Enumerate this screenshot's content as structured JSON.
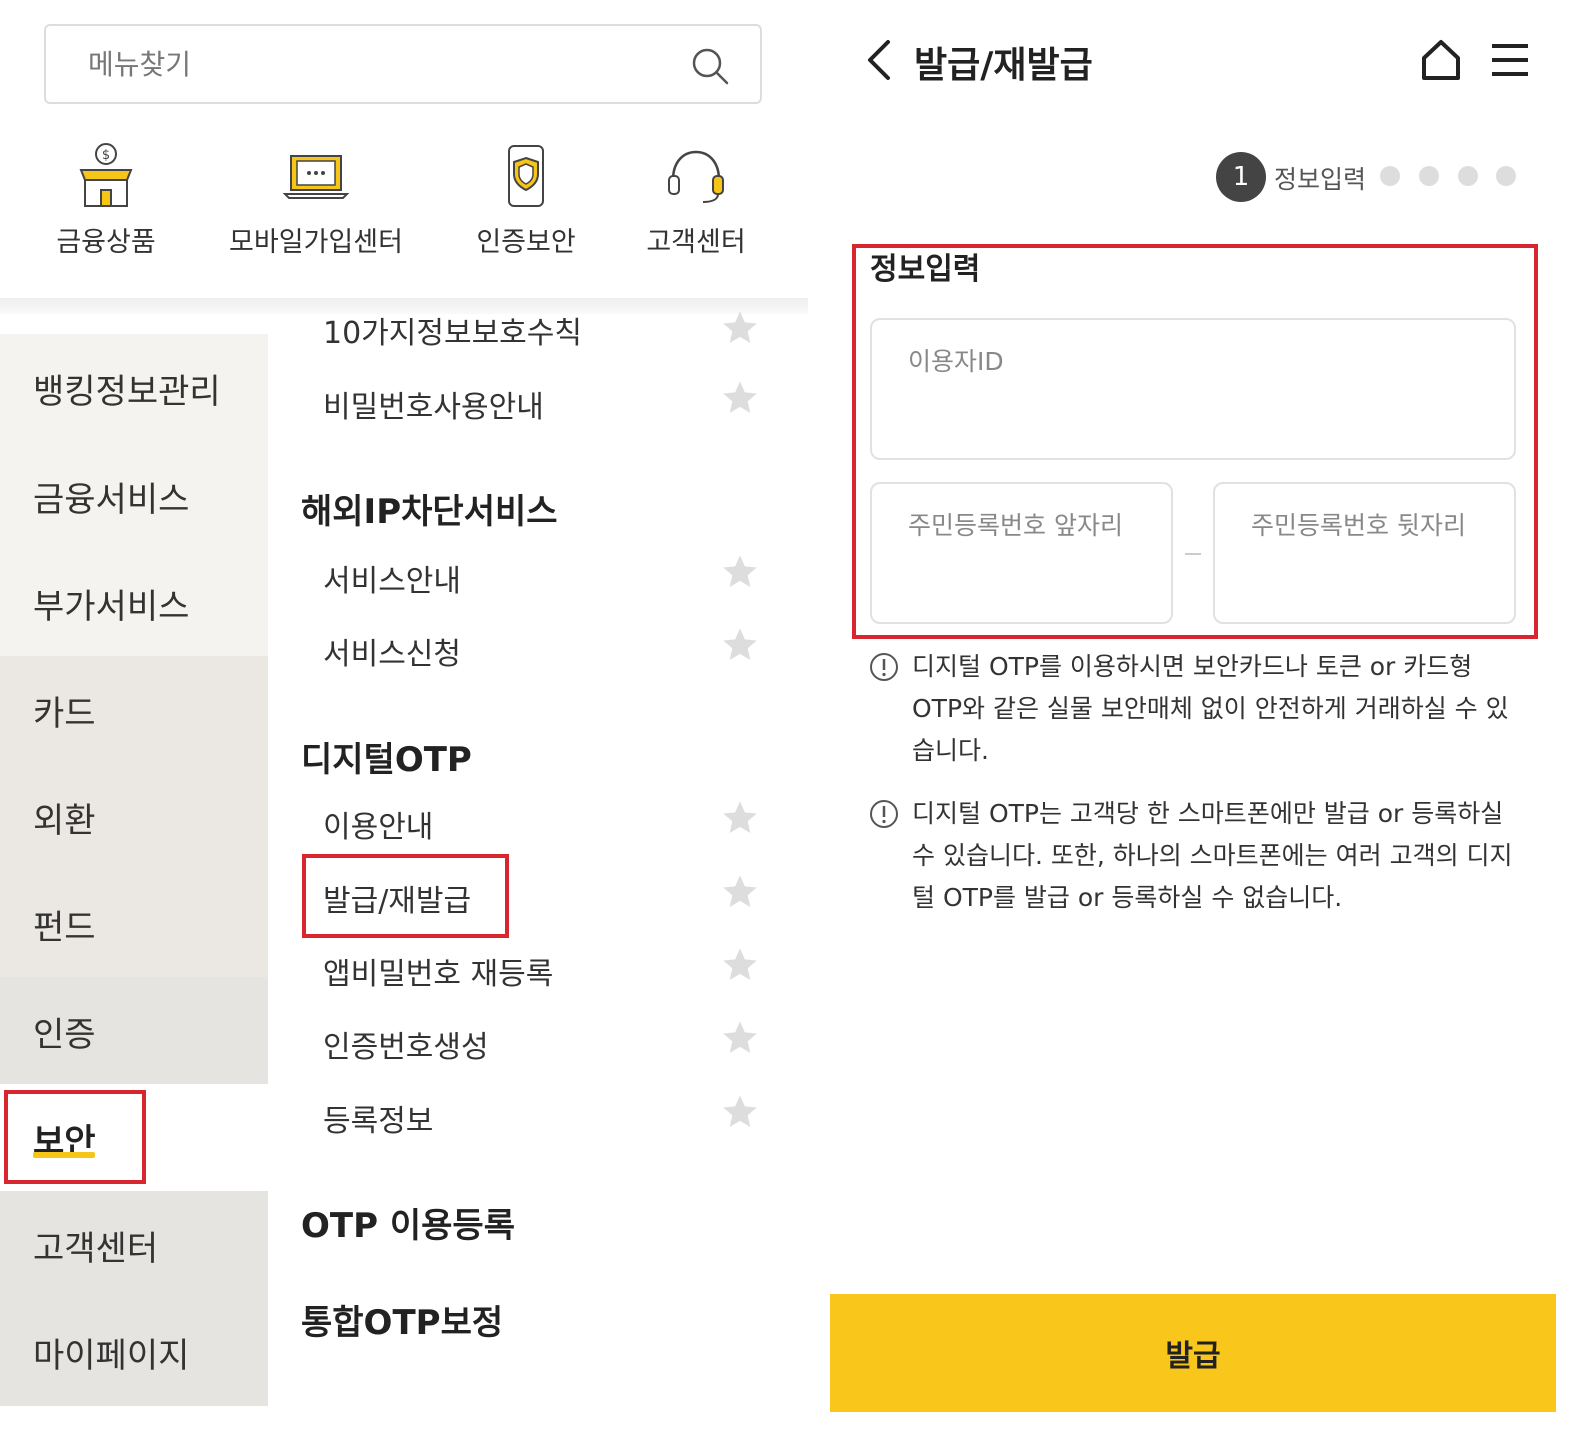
{
  "search": {
    "placeholder": "메뉴찾기"
  },
  "quick_menu": [
    {
      "label": "금융상품",
      "icon": "store-money-icon"
    },
    {
      "label": "모바일가입센터",
      "icon": "laptop-chat-icon"
    },
    {
      "label": "인증보안",
      "icon": "phone-shield-icon"
    },
    {
      "label": "고객센터",
      "icon": "headset-icon"
    }
  ],
  "sidebar": {
    "items": [
      "뱅킹정보관리",
      "금융서비스",
      "부가서비스",
      "카드",
      "외환",
      "펀드",
      "인증",
      "보안",
      "고객센터",
      "마이페이지"
    ],
    "active": "보안"
  },
  "menu": {
    "top_items": [
      "10가지정보보호수칙",
      "비밀번호사용안내"
    ],
    "section1": {
      "title": "해외IP차단서비스",
      "items": [
        "서비스안내",
        "서비스신청"
      ]
    },
    "section2": {
      "title": "디지털OTP",
      "items": [
        "이용안내",
        "발급/재발급",
        "앱비밀번호 재등록",
        "인증번호생성",
        "등록정보"
      ]
    },
    "section3": {
      "title": "OTP 이용등록"
    },
    "section4": {
      "title": "통합OTP보정"
    }
  },
  "header": {
    "title": "발급/재발급"
  },
  "stepper": {
    "current": "1",
    "label": "정보입력"
  },
  "form": {
    "section_title": "정보입력",
    "user_id_placeholder": "이용자ID",
    "rrn_front_placeholder": "주민등록번호 앞자리",
    "rrn_back_placeholder": "주민등록번호 뒷자리"
  },
  "notices": [
    "디지털 OTP를 이용하시면 보안카드나 토큰 or 카드형 OTP와 같은 실물 보안매체 없이 안전하게 거래하실 수 있습니다.",
    "디지털 OTP는 고객당 한 스마트폰에만 발급 or 등록하실 수 있습니다. 또한, 하나의 스마트폰에는 여러 고객의 디지털 OTP를 발급 or 등록하실 수 없습니다."
  ],
  "button": {
    "issue": "발급"
  },
  "colors": {
    "accent": "#f9c61c",
    "highlight": "#d7262e",
    "underline": "#f5c518"
  }
}
